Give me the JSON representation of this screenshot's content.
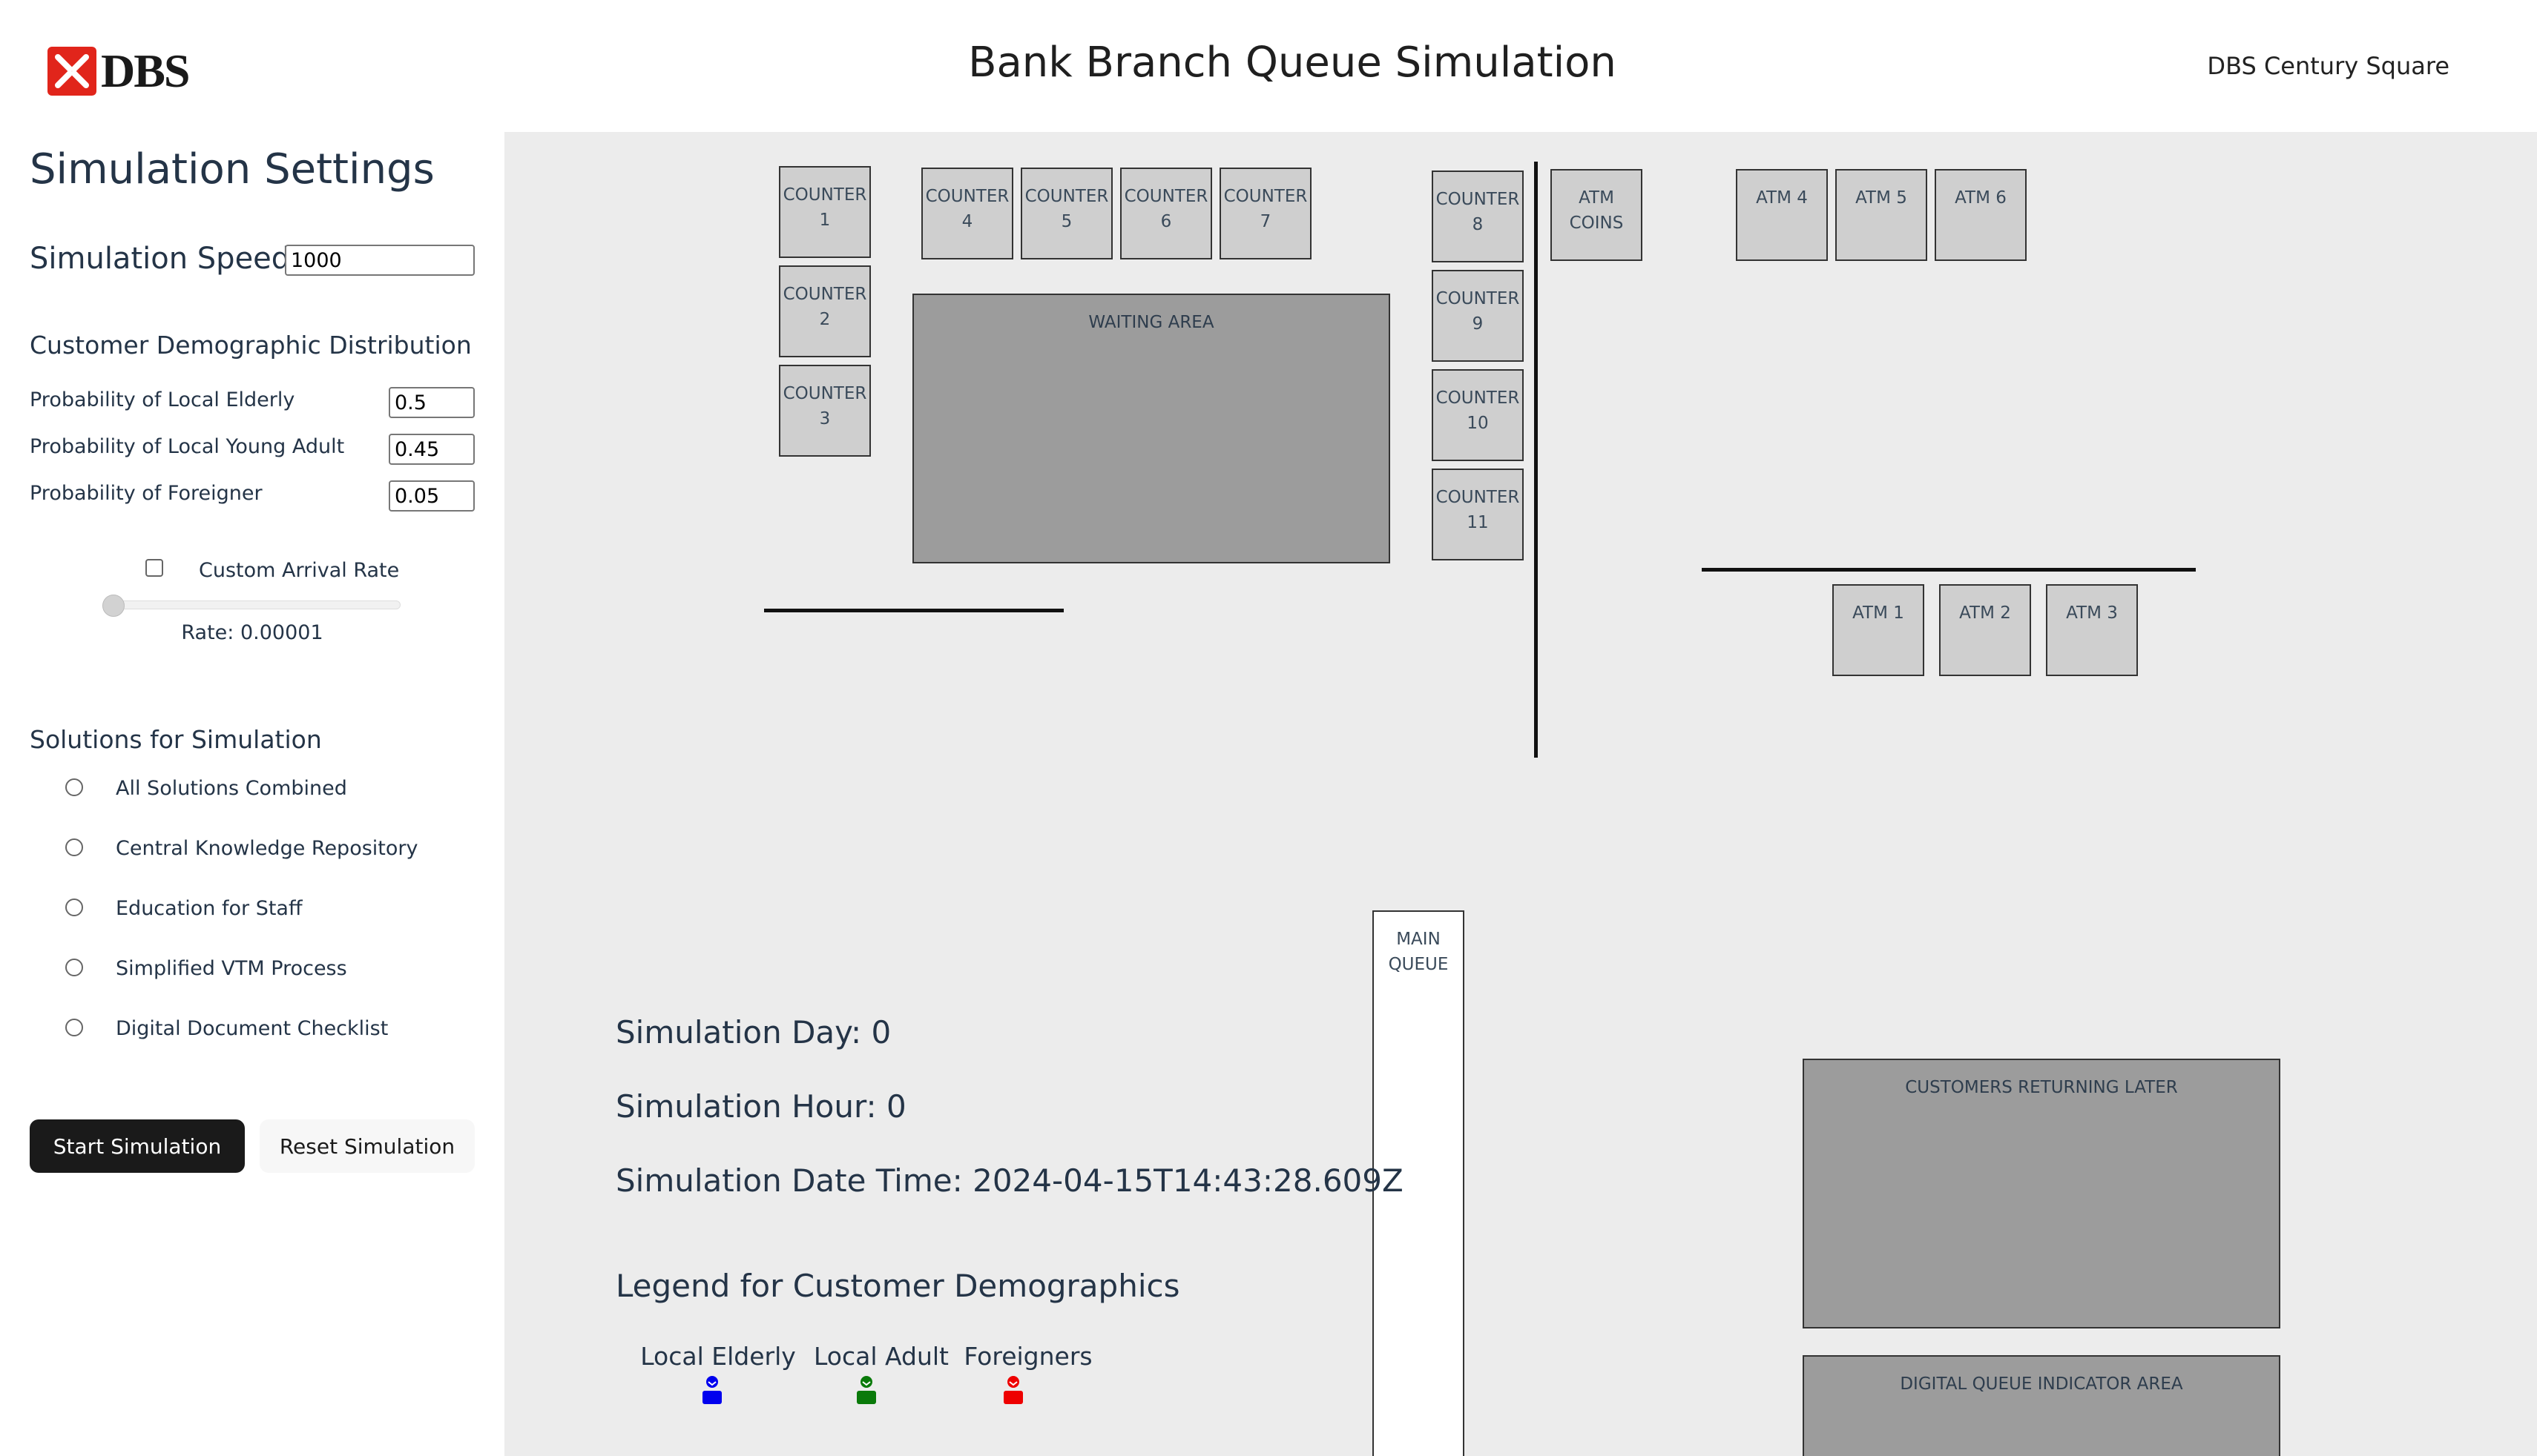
{
  "header": {
    "logo_text": "DBS",
    "title": "Bank Branch Queue Simulation",
    "branch": "DBS Century Square"
  },
  "sidebar": {
    "heading": "Simulation Settings",
    "speed_label": "Simulation Speed",
    "speed_value": "1000",
    "demographic_heading": "Customer Demographic Distribution",
    "probabilities": [
      {
        "label": "Probability of Local Elderly",
        "value": "0.5"
      },
      {
        "label": "Probability of Local Young Adult",
        "value": "0.45"
      },
      {
        "label": "Probability of Foreigner",
        "value": "0.05"
      }
    ],
    "custom_rate_label": "Custom Arrival Rate",
    "custom_rate_checked": false,
    "rate_text": "Rate: 0.00001",
    "slider_fraction": 0,
    "solutions_heading": "Solutions for Simulation",
    "solutions": [
      "All Solutions Combined",
      "Central Knowledge Repository",
      "Education for Staff",
      "Simplified VTM Process",
      "Digital Document Checklist"
    ],
    "start_label": "Start Simulation",
    "reset_label": "Reset Simulation"
  },
  "floor": {
    "counters": [
      "COUNTER\n1",
      "COUNTER\n2",
      "COUNTER\n3",
      "COUNTER\n4",
      "COUNTER\n5",
      "COUNTER\n6",
      "COUNTER\n7",
      "COUNTER\n8",
      "COUNTER\n9",
      "COUNTER\n10",
      "COUNTER\n11"
    ],
    "atm_coins": "ATM COINS",
    "atms": [
      "ATM 1",
      "ATM 2",
      "ATM 3",
      "ATM 4",
      "ATM 5",
      "ATM 6"
    ],
    "waiting_area": "WAITING AREA",
    "main_queue": "MAIN\nQUEUE",
    "returning_area": "CUSTOMERS RETURNING LATER",
    "digital_queue_area": "DIGITAL QUEUE INDICATOR AREA"
  },
  "status": {
    "day": "Simulation Day: 0",
    "hour": "Simulation Hour: 0",
    "datetime": "Simulation Date Time: 2024-04-15T14:43:28.609Z"
  },
  "legend": {
    "title": "Legend for Customer Demographics",
    "items": [
      {
        "label": "Local Elderly",
        "color": "#0000ee",
        "icon": "person-icon"
      },
      {
        "label": "Local Adult",
        "color": "#0a7a0a",
        "icon": "person-icon"
      },
      {
        "label": "Foreigners",
        "color": "#ee0000",
        "icon": "person-icon"
      }
    ]
  },
  "colors": {
    "logo_red": "#e1251b",
    "area_gray": "#9c9c9c",
    "station_gray": "#cfcfcf",
    "canvas_bg": "#ececec"
  }
}
